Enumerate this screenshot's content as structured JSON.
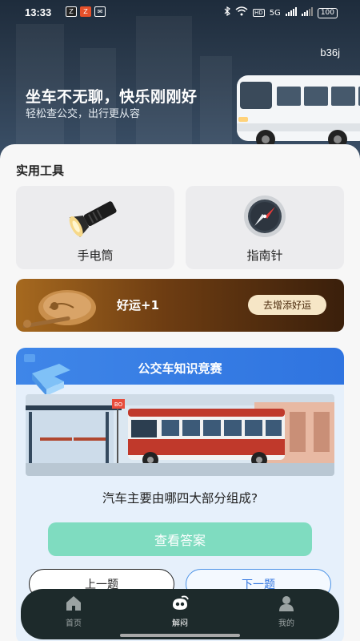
{
  "status": {
    "time": "13:33",
    "battery": "100",
    "signal": "5G"
  },
  "hero": {
    "tag": "b36j",
    "title": "坐车不无聊，快乐刚刚好",
    "subtitle": "轻松查公交，出行更从容"
  },
  "tools": {
    "section_title": "实用工具",
    "items": [
      {
        "label": "手电筒",
        "icon": "flashlight-icon"
      },
      {
        "label": "指南针",
        "icon": "compass-icon"
      }
    ]
  },
  "luck": {
    "text": "好运+1",
    "button": "去增添好运"
  },
  "quiz": {
    "title": "公交车知识竞赛",
    "bus_sign": "BO",
    "question": "汽车主要由哪四大部分组成?",
    "answer_button": "查看答案",
    "prev_button": "上一题",
    "next_button": "下一题"
  },
  "tabbar": {
    "items": [
      {
        "label": "首页",
        "icon": "home-icon",
        "active": false
      },
      {
        "label": "解闷",
        "icon": "relief-icon",
        "active": true
      },
      {
        "label": "我的",
        "icon": "profile-icon",
        "active": false
      }
    ]
  },
  "colors": {
    "quiz_header": "#3f86e8",
    "answer_button": "#7fdcc0",
    "tabbar": "#1d2a2b",
    "luck_banner": "#6e3d12"
  }
}
